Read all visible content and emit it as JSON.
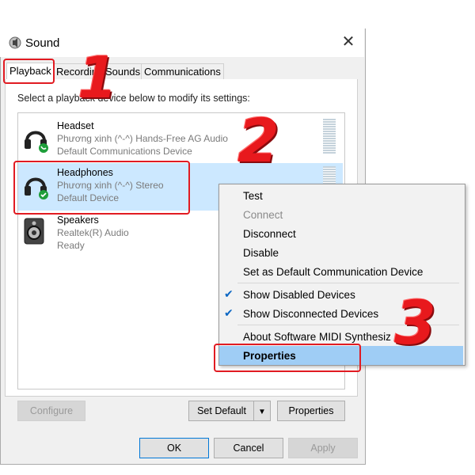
{
  "window": {
    "title": "Sound",
    "close_label": "✕"
  },
  "tabs": [
    {
      "label": "Playback",
      "active": true
    },
    {
      "label": "Recording",
      "active": false
    },
    {
      "label": "Sounds",
      "active": false
    },
    {
      "label": "Communications",
      "active": false
    }
  ],
  "instruction": "Select a playback device below to modify its settings:",
  "devices": [
    {
      "name": "Headset",
      "line1": "Phương xinh (^-^) Hands-Free AG Audio",
      "line2": "Default Communications Device",
      "icon": "headset-icon",
      "status": "phone-badge"
    },
    {
      "name": "Headphones",
      "line1": "Phương xinh (^-^) Stereo",
      "line2": "Default Device",
      "icon": "headphones-icon",
      "status": "check-badge",
      "selected": true
    },
    {
      "name": "Speakers",
      "line1": "Realtek(R) Audio",
      "line2": "Ready",
      "icon": "speaker-icon"
    }
  ],
  "context_menu": {
    "items": [
      {
        "label": "Test",
        "disabled": false
      },
      {
        "label": "Connect",
        "disabled": true
      },
      {
        "label": "Disconnect",
        "disabled": false
      },
      {
        "label": "Disable",
        "disabled": false
      },
      {
        "label": "Set as Default Communication Device",
        "disabled": false
      },
      {
        "label": "Show Disabled Devices",
        "checked": true
      },
      {
        "label": "Show Disconnected Devices",
        "checked": true
      },
      {
        "label": "About Software MIDI Synthesiz",
        "disabled": false
      },
      {
        "label": "Properties",
        "highlighted": true
      }
    ]
  },
  "buttons": {
    "configure": "Configure",
    "set_default": "Set Default",
    "properties": "Properties",
    "ok": "OK",
    "cancel": "Cancel",
    "apply": "Apply"
  },
  "annotations": {
    "step1": "1",
    "step2": "2",
    "step3": "3"
  },
  "colors": {
    "accent": "#0078d7",
    "selection": "#cce8ff",
    "highlight": "#9fcdf5",
    "annotation_red": "#e11b22"
  }
}
